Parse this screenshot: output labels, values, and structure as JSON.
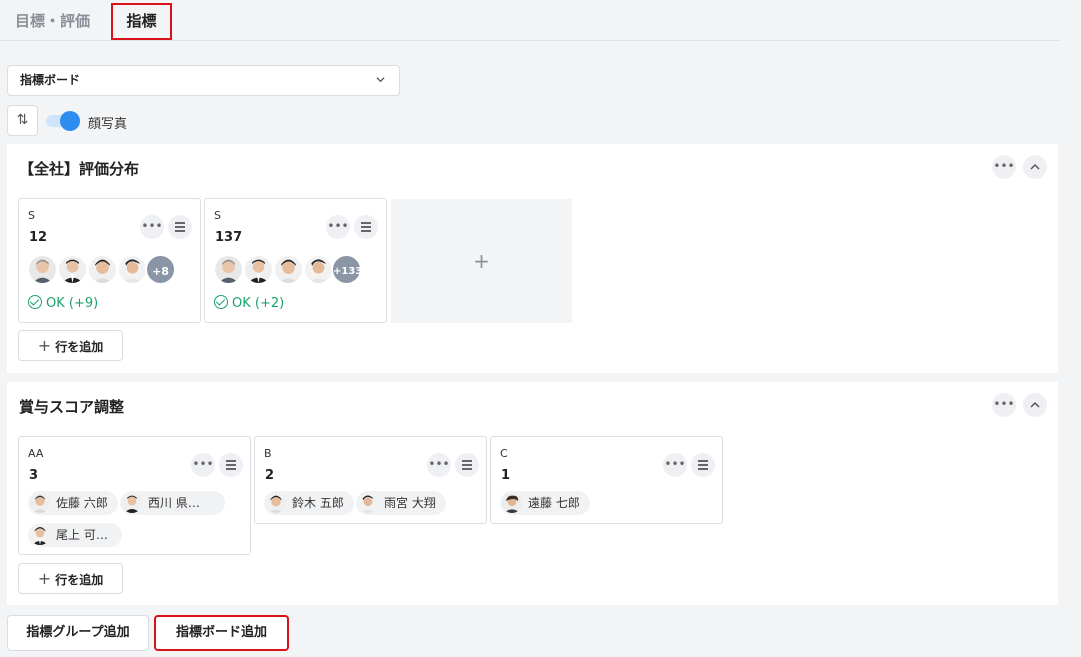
{
  "tabs": {
    "goals": "目標・評価",
    "metrics": "指標"
  },
  "board_select": {
    "value": "指標ボード"
  },
  "toolbar": {
    "sort_icon": "⇅",
    "photo_toggle_label": "顔写真",
    "photo_toggle_on": true
  },
  "groups": [
    {
      "title": "【全社】評価分布",
      "cards": [
        {
          "label": "S",
          "count": "12",
          "more": "+8",
          "status": "OK (+9)"
        },
        {
          "label": "S",
          "count": "137",
          "more": "+133",
          "status": "OK (+2)"
        }
      ],
      "add_cell": "+",
      "add_row": "行を追加"
    },
    {
      "title": "賞与スコア調整",
      "cards": [
        {
          "label": "AA",
          "count": "3",
          "people": [
            "佐藤 六郎",
            "西川 県…",
            "尾上 可…"
          ]
        },
        {
          "label": "B",
          "count": "2",
          "people": [
            "鈴木 五郎",
            "雨宮 大翔"
          ]
        },
        {
          "label": "C",
          "count": "1",
          "people": [
            "遠藤 七郎"
          ]
        }
      ],
      "add_row": "行を追加"
    }
  ],
  "buttons": {
    "add_group": "指標グループ追加",
    "add_board": "指標ボード追加"
  },
  "colors": {
    "accent": "#2d8cf0",
    "ok": "#1aa36b",
    "highlight": "#d9111a"
  }
}
